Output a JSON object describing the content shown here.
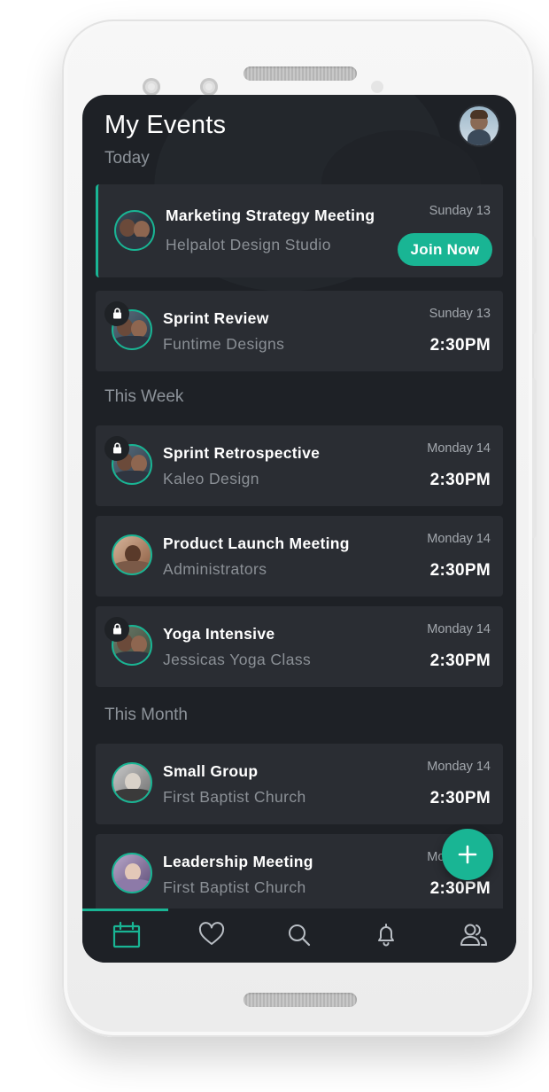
{
  "header": {
    "title": "My Events"
  },
  "sections": {
    "today": "Today",
    "this_week": "This Week",
    "this_month": "This Month"
  },
  "events": [
    {
      "title": "Marketing Strategy Meeting",
      "organizer": "Helpalot Design Studio",
      "date": "Sunday 13",
      "action": "Join Now",
      "locked": false,
      "active": true
    },
    {
      "title": "Sprint Review",
      "organizer": "Funtime Designs",
      "date": "Sunday 13",
      "time": "2:30PM",
      "locked": true
    },
    {
      "title": "Sprint Retrospective",
      "organizer": "Kaleo Design",
      "date": "Monday 14",
      "time": "2:30PM",
      "locked": true
    },
    {
      "title": "Product Launch Meeting",
      "organizer": "Administrators",
      "date": "Monday 14",
      "time": "2:30PM",
      "locked": false
    },
    {
      "title": "Yoga Intensive",
      "organizer": "Jessicas Yoga Class",
      "date": "Monday 14",
      "time": "2:30PM",
      "locked": true
    },
    {
      "title": "Small Group",
      "organizer": "First Baptist Church",
      "date": "Monday 14",
      "time": "2:30PM",
      "locked": false
    },
    {
      "title": "Leadership Meeting",
      "organizer": "First Baptist Church",
      "date": "Monday 14",
      "time": "2:30PM",
      "locked": false
    }
  ],
  "tabs": [
    {
      "icon": "calendar-icon",
      "active": true
    },
    {
      "icon": "heart-icon"
    },
    {
      "icon": "search-icon"
    },
    {
      "icon": "bell-icon"
    },
    {
      "icon": "users-icon"
    }
  ],
  "colors": {
    "accent": "#19b594",
    "background": "#1e2126",
    "card": "#2a2d33",
    "muted_text": "#8b9096"
  }
}
